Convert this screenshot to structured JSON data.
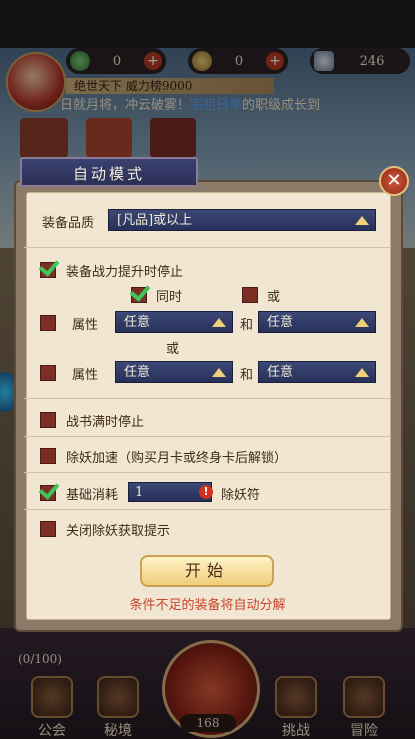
{
  "hud": {
    "res1_value": "0",
    "res2_value": "0",
    "res3_value": "246",
    "player_strip": "绝世天下  威力榜9000",
    "ticker_prefix": "日就月将，冲云破雾！",
    "ticker_highlight": "宗祖日季",
    "ticker_suffix": "的职级成长到"
  },
  "dialog": {
    "title": "自动模式",
    "close_glyph": "✕",
    "quality_label": "装备品质",
    "quality_value": "[凡品]或以上",
    "power_stop_label": "装备战力提升时停止",
    "same_time_label": "同时",
    "or_label": "或",
    "attr_label": "属性",
    "and_label": "和",
    "any_value": "任意",
    "or_divider": "或",
    "battle_book_label": "战书满时停止",
    "speed_label": "除妖加速（购买月卡或终身卡后解锁）",
    "base_cost_label": "基础消耗",
    "base_cost_value": "1",
    "talisman_label": "除妖符",
    "close_tip_label": "关闭除妖获取提示",
    "start_button": "开始",
    "hint": "条件不足的装备将自动分解"
  },
  "checkboxes": {
    "power_stop": true,
    "same_time": true,
    "or_opt": false,
    "attr_row1": false,
    "attr_row2": false,
    "battle_book": false,
    "speed": false,
    "base_cost": true,
    "close_tip": false
  },
  "bottom": {
    "quest_progress": "(0/100)",
    "counter": "168",
    "btn_guild": "公会",
    "btn_secret": "秘境",
    "btn_challenge": "挑战",
    "btn_adventure": "冒险"
  }
}
